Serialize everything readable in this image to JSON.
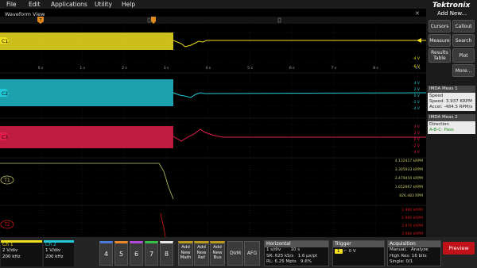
{
  "menubar": {
    "items": [
      "File",
      "Edit",
      "Applications",
      "Utility",
      "Help"
    ]
  },
  "brand": {
    "logo": "Tektronix",
    "add_new": "Add New..."
  },
  "waveform_view": {
    "title": "Waveform View",
    "trigger_marker": "T",
    "time_ticks": [
      "0 s",
      "1 s",
      "2 s",
      "3 s",
      "4 s",
      "5 s",
      "6 s",
      "7 s",
      "8 s",
      "9 s"
    ]
  },
  "channels": [
    {
      "id": "ch1",
      "label": "C1",
      "color": "#f0e020",
      "scale_labels": [
        "-4 V",
        "-6 V"
      ]
    },
    {
      "id": "ch2",
      "label": "C2",
      "color": "#22c8d8",
      "scale_labels": [
        "4 V",
        "2 V",
        "0 V",
        "-2 V",
        "-4 V"
      ]
    },
    {
      "id": "ch3",
      "label": "C3",
      "color": "#e0204a",
      "scale_labels": [
        "4 V",
        "2 V",
        "0 V",
        "-2 V",
        "-4 V"
      ]
    }
  ],
  "track1": {
    "label": "T1",
    "color": "#f0e020",
    "scale_labels": [
      "4.132417 kRPM",
      "3.305933 kRPM",
      "2.479450 kRPM",
      "1.652967 kRPM",
      "826.483 RPM"
    ]
  },
  "track2": {
    "label": "T2",
    "color": "#d01818",
    "scale_labels": [
      "1.960 kRPM",
      "1.960 kRPM",
      "2.970 kRPM",
      "3.960 kRPM",
      "4.950 kRPM"
    ]
  },
  "sidebar": {
    "buttons": [
      {
        "id": "cursors",
        "label": "Cursors"
      },
      {
        "id": "callout",
        "label": "Callout"
      },
      {
        "id": "measure",
        "label": "Measure"
      },
      {
        "id": "search",
        "label": "Search"
      },
      {
        "id": "results-table",
        "label": "Results Table"
      },
      {
        "id": "plot",
        "label": "Plot"
      },
      {
        "id": "more",
        "label": "More..."
      }
    ],
    "meas1": {
      "title": "IMDA Meas 1",
      "line1": "Speed",
      "line2": "Speed: 3.937 KRPM",
      "line3": "Accel:   -484.5 RPM/s"
    },
    "meas2": {
      "title": "IMDA Meas 2",
      "line1": "Direction",
      "line2": "A-B-C: Pass"
    }
  },
  "bottom": {
    "ch1": {
      "name": "Ch 1",
      "scale": "2 V/div",
      "bw": "200 kHz"
    },
    "ch2": {
      "name": "Ch 2",
      "scale": "1 V/div",
      "bw": "200 kHz"
    },
    "channel_buttons": [
      "4",
      "5",
      "6",
      "7",
      "8"
    ],
    "add_buttons": [
      {
        "id": "add-math",
        "label": "Add New Math"
      },
      {
        "id": "add-ref",
        "label": "Add New Ref"
      },
      {
        "id": "add-bus",
        "label": "Add New Bus"
      }
    ],
    "dvm": "DVM",
    "afg": "AFG",
    "horizontal": {
      "title": "Horizontal",
      "scale": "1 s/div",
      "record": "10 s",
      "sr": "SR: 625 kS/s",
      "pt": "1.6 µs/pt",
      "rl": "RL: 6.25 Mpts",
      "pos": "9.6%"
    },
    "trigger": {
      "title": "Trigger",
      "source": "1",
      "level": "0 V"
    },
    "acquisition": {
      "title": "Acquisition",
      "mode": "Manual,",
      "state": "Analyze",
      "res": "High Res: 16 bits",
      "single": "Single: 0/1"
    },
    "preview": "Preview"
  }
}
